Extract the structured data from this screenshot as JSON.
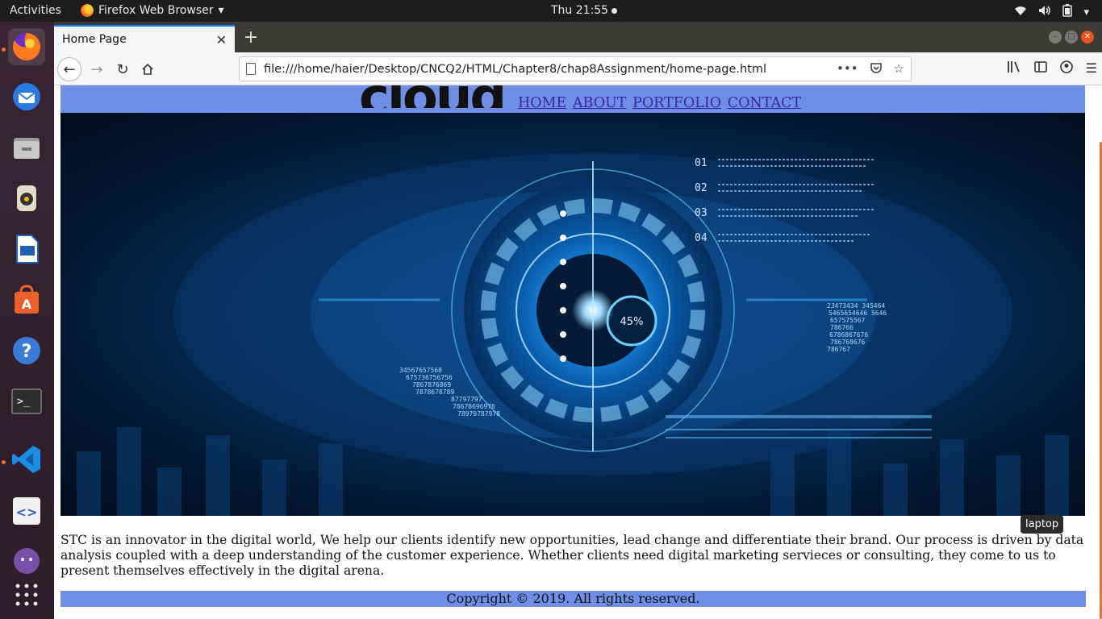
{
  "system": {
    "activities": "Activities",
    "app_name": "Firefox Web Browser",
    "clock": "Thu 21:55"
  },
  "dock": {
    "items": [
      "firefox-icon",
      "thunderbird-icon",
      "files-icon",
      "rhythmbox-icon",
      "writer-icon",
      "software-icon",
      "help-icon",
      "terminal-icon",
      "vscode-icon",
      "editor-icon",
      "github-icon",
      "app-grid-icon"
    ]
  },
  "browser": {
    "tab_title": "Home Page",
    "url": "file:///home/haier/Desktop/CNCQ2/HTML/Chapter8/chap8Assignment/home-page.html"
  },
  "page": {
    "logo_text": "cloud",
    "nav": [
      "HOME",
      "ABOUT",
      "PORTFOLIO",
      "CONTACT"
    ],
    "hero": {
      "gauge": "45%",
      "rows": [
        "01",
        "02",
        "03",
        "04"
      ],
      "numbers_left": [
        "34567657568",
        "675736756756",
        "7867876869",
        "7878678789",
        "87797797",
        "78678696976",
        "78979787978"
      ],
      "numbers_right": [
        "23473434 345464",
        "5465654646 5646",
        "657575567",
        "786766",
        "6786867676",
        "786768676",
        "786767"
      ]
    },
    "tooltip": "laptop",
    "intro": "STC is an innovator in the digital world, We help our clients identify new opportunities, lead change and differentiate their brand. Our process is driven by data analysis coupled with a deep understanding of the customer experience. Whether clients need digital marketing servieces or consulting, they come to us to present themselves effectively in the digital arena.",
    "footer": "Copyright © 2019. All rights reserved."
  },
  "colors": {
    "header_bg": "#6f8fe6",
    "link": "#3d23a8",
    "accent": "#e95420"
  }
}
